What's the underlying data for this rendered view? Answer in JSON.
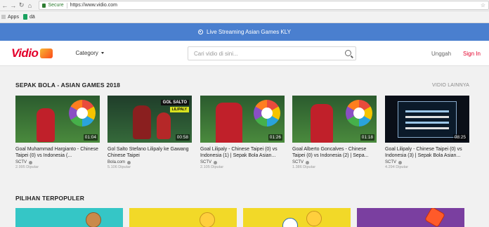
{
  "browser": {
    "secure_label": "Secure",
    "url": "https://www.vidio.com",
    "bookmarks": [
      {
        "label": "Apps"
      },
      {
        "label": "dā"
      }
    ]
  },
  "banner": {
    "text": "Live Streaming Asian Games KLY"
  },
  "header": {
    "logo": "Vidio",
    "category": "Category",
    "search_placeholder": "Cari vidio di sini...",
    "upload": "Unggah",
    "signin": "Sign In"
  },
  "section1": {
    "title": "SEPAK BOLA - ASIAN GAMES 2018",
    "more": "VIDIO LAINNYA",
    "videos": [
      {
        "title": "Goal Muhammad Hargianto - Chinese Taipei (0) vs Indonesia (...",
        "channel": "SCTV",
        "views": "2.995 Diputar",
        "duration": "01:04"
      },
      {
        "title": "Gol Salto Stefano Lilipaly ke Gawang Chinese Taipei",
        "channel": "Bola.com",
        "views": "5.106 Diputar",
        "duration": "00:58",
        "tag": "GOL SALTO",
        "tag2": "LILIPALY"
      },
      {
        "title": "Goal Lilipaly - Chinese Taipei (0) vs Indonesia (1) | Sepak Bola Asian...",
        "channel": "SCTV",
        "views": "2.105 Diputar",
        "duration": "01:26"
      },
      {
        "title": "Goal Alberto Goncalves - Chinese Taipei (0) vs Indonesia (2) | Sepa...",
        "channel": "SCTV",
        "views": "1.386 Diputar",
        "duration": "01:18"
      },
      {
        "title": "Goal Lilipaly - Chinese Taipei (0) vs Indonesia (3) | Sepak Bola Asian...",
        "channel": "SCTV",
        "views": "4.294 Diputar",
        "duration": "08:25"
      }
    ]
  },
  "section2": {
    "title": "PILIHAN TERPOPULER"
  },
  "colors": {
    "brand": "#e4002b",
    "banner": "#4a7fcf",
    "secure": "#2e7d32"
  }
}
